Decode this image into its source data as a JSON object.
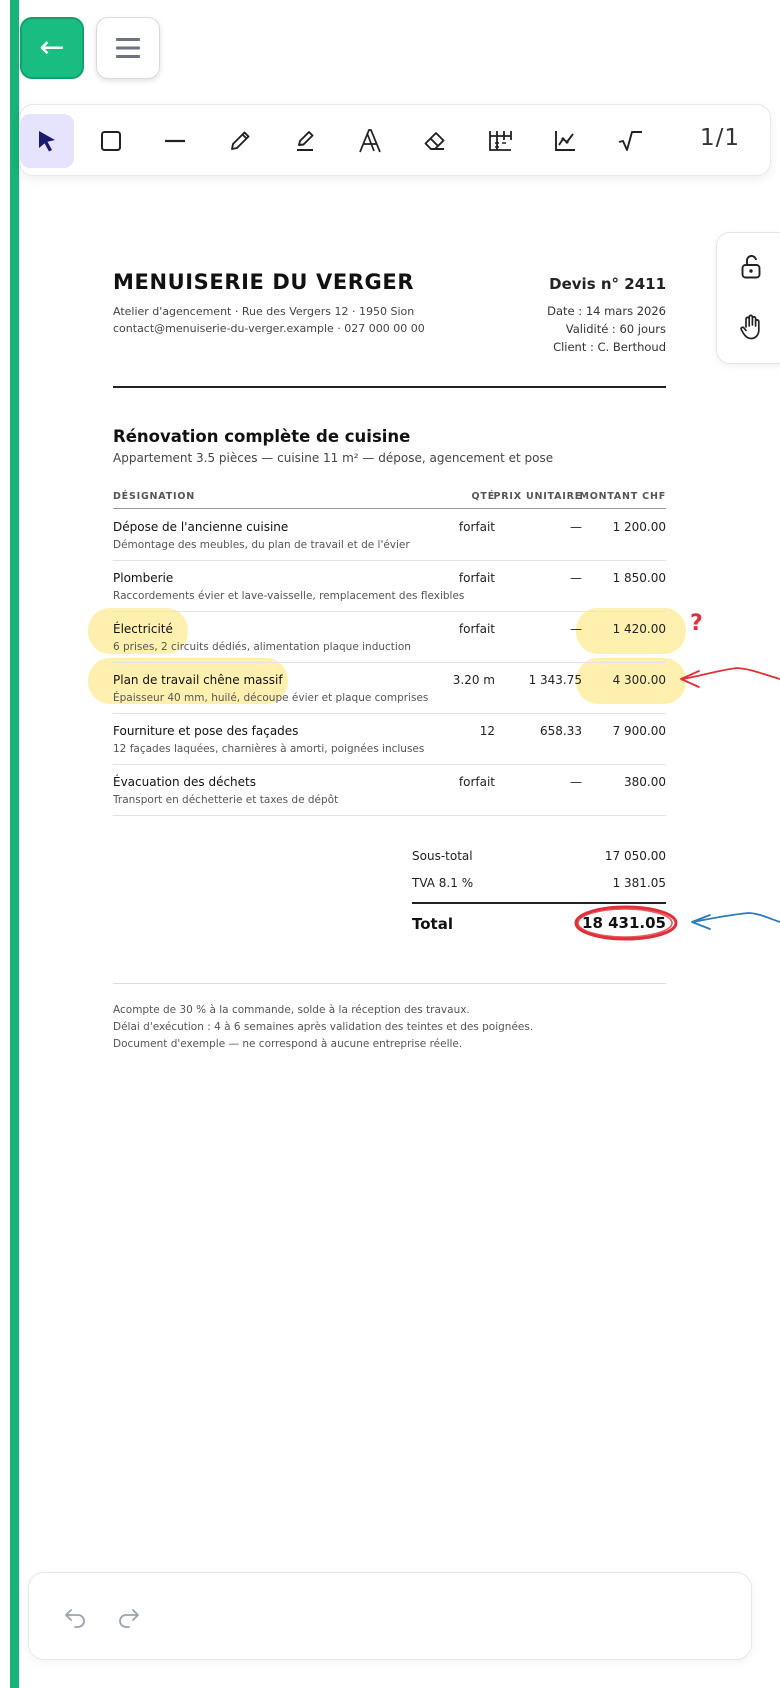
{
  "toolbar": {
    "back_icon": "←",
    "page_counter": "1/1",
    "tools": [
      "select",
      "rectangle",
      "line",
      "pencil",
      "highlighter",
      "text",
      "eraser",
      "table",
      "graph",
      "math"
    ]
  },
  "document": {
    "company": "MENUISERIE DU VERGER",
    "address": "Atelier d'agencement · Rue des Vergers 12 · 1950 Sion",
    "contact": "contact@menuiserie-du-verger.example · 027 000 00 00",
    "quote_number": "Devis n° 2411",
    "date": "Date : 14 mars 2026",
    "validity": "Validité : 60 jours",
    "client": "Client : C. Berthoud",
    "project_title": "Rénovation complète de cuisine",
    "project_subtitle": "Appartement 3.5 pièces — cuisine 11 m² — dépose, agencement et pose",
    "headers": {
      "designation": "DÉSIGNATION",
      "qty": "QTÉ",
      "unit_price": "PRIX UNITAIRE",
      "amount": "MONTANT CHF"
    },
    "rows": [
      {
        "name": "Dépose de l'ancienne cuisine",
        "desc": "Démontage des meubles, du plan de travail et de l'évier",
        "qty": "forfait",
        "unit": "—",
        "amount": "1 200.00"
      },
      {
        "name": "Plomberie",
        "desc": "Raccordements évier et lave-vaisselle, remplacement des flexibles",
        "qty": "forfait",
        "unit": "—",
        "amount": "1 850.00"
      },
      {
        "name": "Électricité",
        "desc": "6 prises, 2 circuits dédiés, alimentation plaque induction",
        "qty": "forfait",
        "unit": "—",
        "amount": "1 420.00"
      },
      {
        "name": "Plan de travail chêne massif",
        "desc": "Épaisseur 40 mm, huilé, découpe évier et plaque comprises",
        "qty": "3.20 m",
        "unit": "1 343.75",
        "amount": "4 300.00"
      },
      {
        "name": "Fourniture et pose des façades",
        "desc": "12 façades laquées, charnières à amorti, poignées incluses",
        "qty": "12",
        "unit": "658.33",
        "amount": "7 900.00"
      },
      {
        "name": "Évacuation des déchets",
        "desc": "Transport en déchetterie et taxes de dépôt",
        "qty": "forfait",
        "unit": "—",
        "amount": "380.00"
      }
    ],
    "subtotal_label": "Sous-total",
    "subtotal": "17 050.00",
    "vat_label": "TVA 8.1 %",
    "vat": "1 381.05",
    "total_label": "Total",
    "total": "18 431.05",
    "notes": [
      "Acompte de 30 % à la commande, solde à la réception des travaux.",
      "Délai d'exécution : 4 à 6 semaines après validation des teintes et des poignées.",
      "Document d'exemple — ne correspond à aucune entreprise réelle."
    ]
  },
  "annotations": {
    "question_mark": "?",
    "highlight_color": "#ffdd50",
    "red_ink": "#e0303a",
    "blue_ink": "#2b7bbf"
  },
  "colors": {
    "accent_green": "#19bd82",
    "active_tool_bg": "#e5e3fd"
  }
}
